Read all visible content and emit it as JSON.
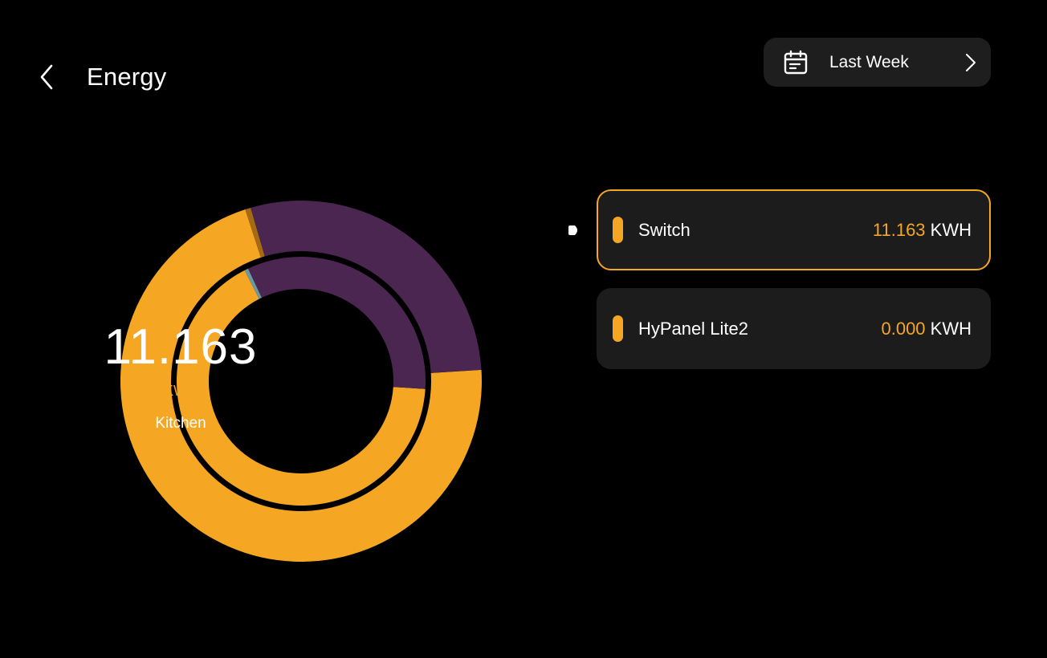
{
  "header": {
    "title": "Energy",
    "back_icon": "chevron-left-icon"
  },
  "date_selector": {
    "label": "Last Week",
    "icon": "calendar-icon",
    "chevron_icon": "chevron-right-icon"
  },
  "summary": {
    "value": "11.163",
    "unit": "KWH",
    "room": "Kitchen"
  },
  "chart_data": {
    "type": "pie",
    "rings": [
      {
        "ring": "outer",
        "slices": [
          {
            "label": "",
            "fraction": 0.71,
            "color": "#f5a623"
          },
          {
            "label": "",
            "fraction": 0.005,
            "color": "#a56a14"
          },
          {
            "label": "",
            "fraction": 0.285,
            "color": "#4a2651"
          }
        ]
      },
      {
        "ring": "inner",
        "slices": [
          {
            "label": "",
            "fraction": 0.665,
            "color": "#f5a623"
          },
          {
            "label": "",
            "fraction": 0.005,
            "color": "#6a9aa0"
          },
          {
            "label": "",
            "fraction": 0.33,
            "color": "#4a2651"
          }
        ]
      }
    ]
  },
  "devices": [
    {
      "name": "Switch",
      "energy": "11.163",
      "unit": "KWH",
      "color": "#f5a623",
      "selected": true
    },
    {
      "name": "HyPanel Lite2",
      "energy": "0.000",
      "unit": "KWH",
      "color": "#f5a623",
      "selected": false
    }
  ],
  "colors": {
    "accent": "#f5a623",
    "purple": "#4a2651",
    "card_bg": "#1c1c1c",
    "background": "#000000"
  }
}
